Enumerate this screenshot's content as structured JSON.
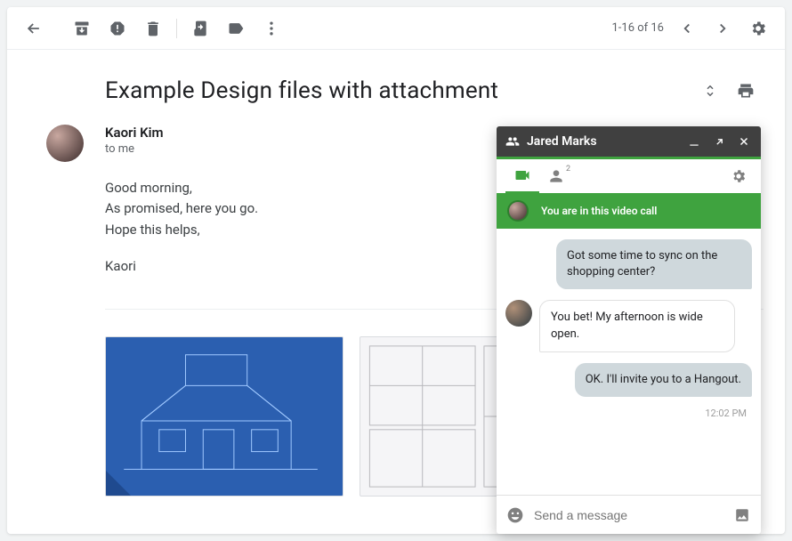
{
  "toolbar": {
    "page_count": "1-16 of 16"
  },
  "subject": "Example Design files with attachment",
  "sender": {
    "name": "Kaori Kim",
    "recipient": "to me"
  },
  "email_body": {
    "para1": "Good morning,\nAs promised, here you go.\nHope this helps,",
    "para2": "Kaori"
  },
  "chat": {
    "contact_name": "Jared Marks",
    "people_badge": "2",
    "banner_text": "You are in this video call",
    "messages": {
      "m1": "Got some time to sync on the shopping center?",
      "m2": "You bet! My afternoon is wide open.",
      "m3": "OK. I'll invite you to a Hangout."
    },
    "timestamp": "12:02 PM",
    "compose_placeholder": "Send a message"
  }
}
